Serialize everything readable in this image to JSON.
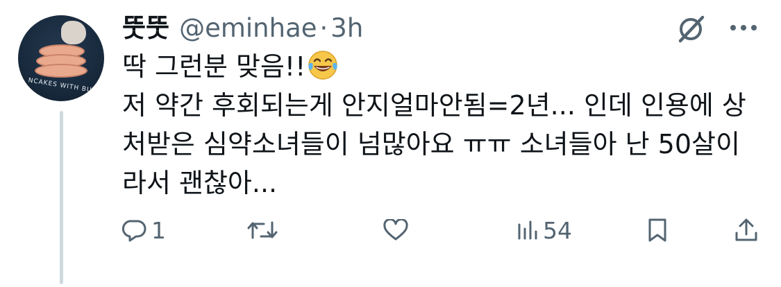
{
  "tweet": {
    "display_name": "뚯뚯",
    "handle": "@eminhae",
    "separator": "·",
    "time": "3h",
    "lines": [
      "딱 그런분 맞음!!",
      "저 약간 후회되는게 안지얼마안됨=2년... 인데 인용에 상",
      "처받은 심약소녀들이 넘많아요 ㅠㅠ 소녀들아 난 50살이",
      "라서 괜찮아..."
    ],
    "emoji": "face-with-tears-of-joy"
  },
  "avatar": {
    "text": "NCAKES WITH BUTTE"
  },
  "actions": {
    "reply_count": "1",
    "retweet_count": "",
    "like_count": "",
    "views_count": "54"
  },
  "colors": {
    "text": "#0f1419",
    "secondary": "#536471",
    "thread_line": "#cfd9de",
    "background": "#ffffff"
  }
}
